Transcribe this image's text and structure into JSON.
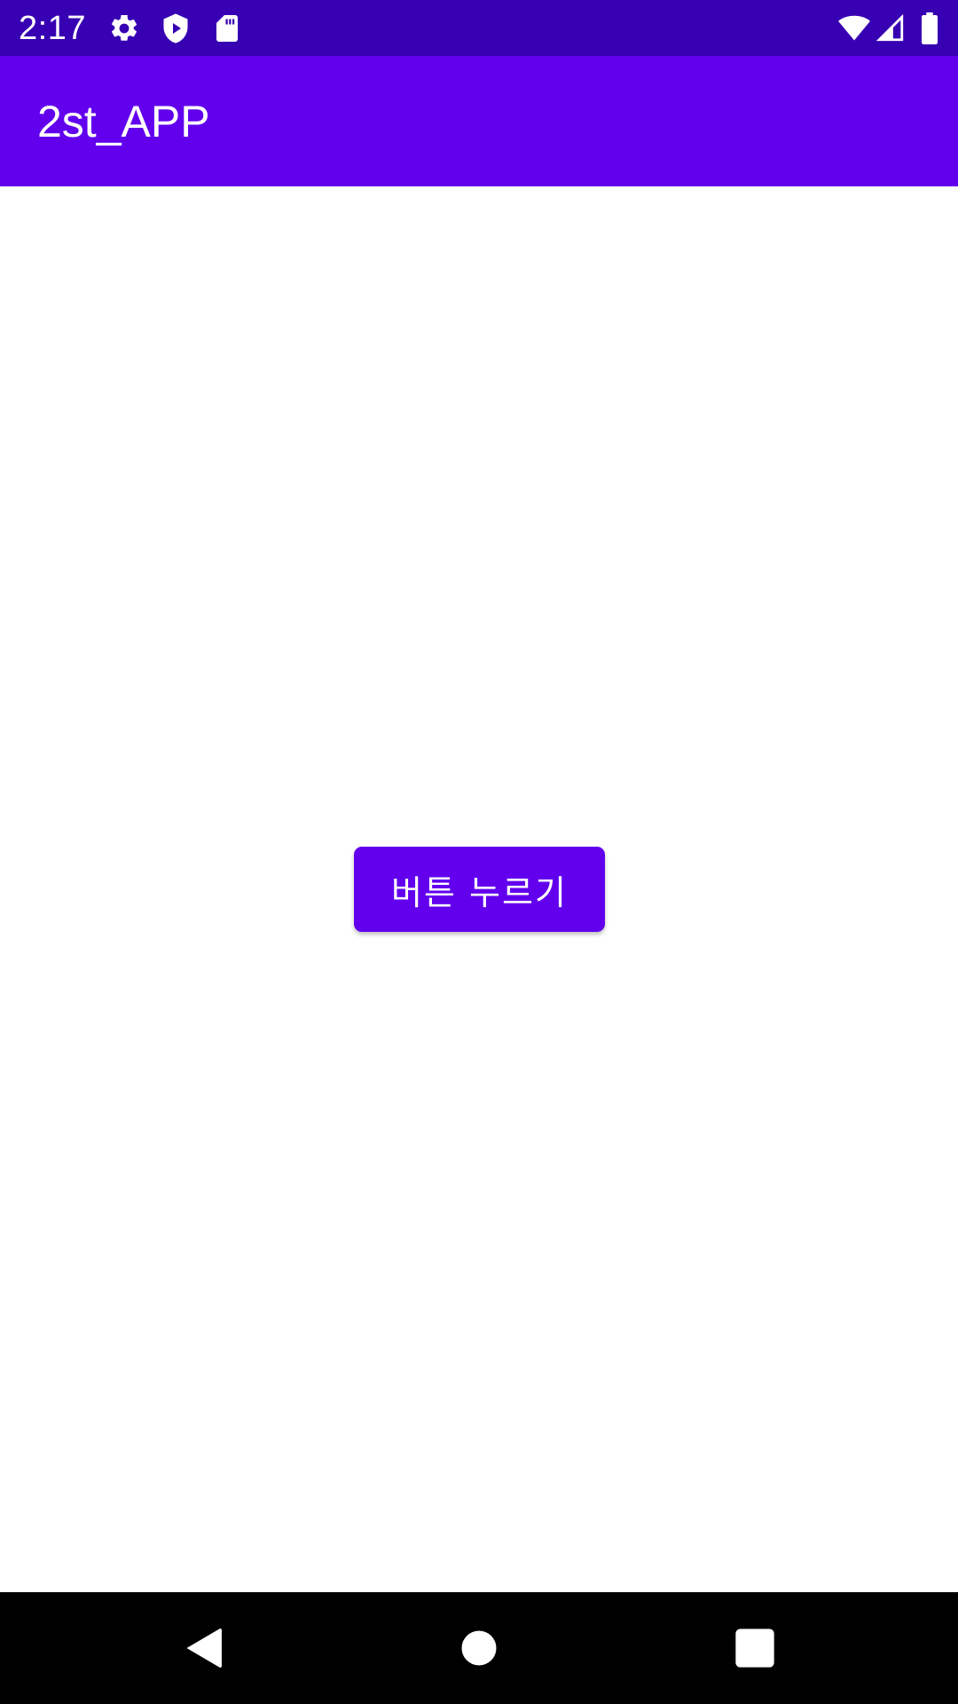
{
  "status_bar": {
    "time": "2:17",
    "left_icons": [
      "gear-icon",
      "play-protect-icon",
      "sd-card-icon"
    ],
    "right_icons": [
      "wifi-icon",
      "signal-icon",
      "battery-icon"
    ],
    "background": "#3700b3"
  },
  "app_bar": {
    "title": "2st_APP",
    "background": "#6200ee"
  },
  "main": {
    "button_label": "버튼 누르기",
    "button_color": "#6200ee"
  },
  "nav_bar": {
    "items": [
      "back-icon",
      "home-icon",
      "recents-icon"
    ]
  }
}
